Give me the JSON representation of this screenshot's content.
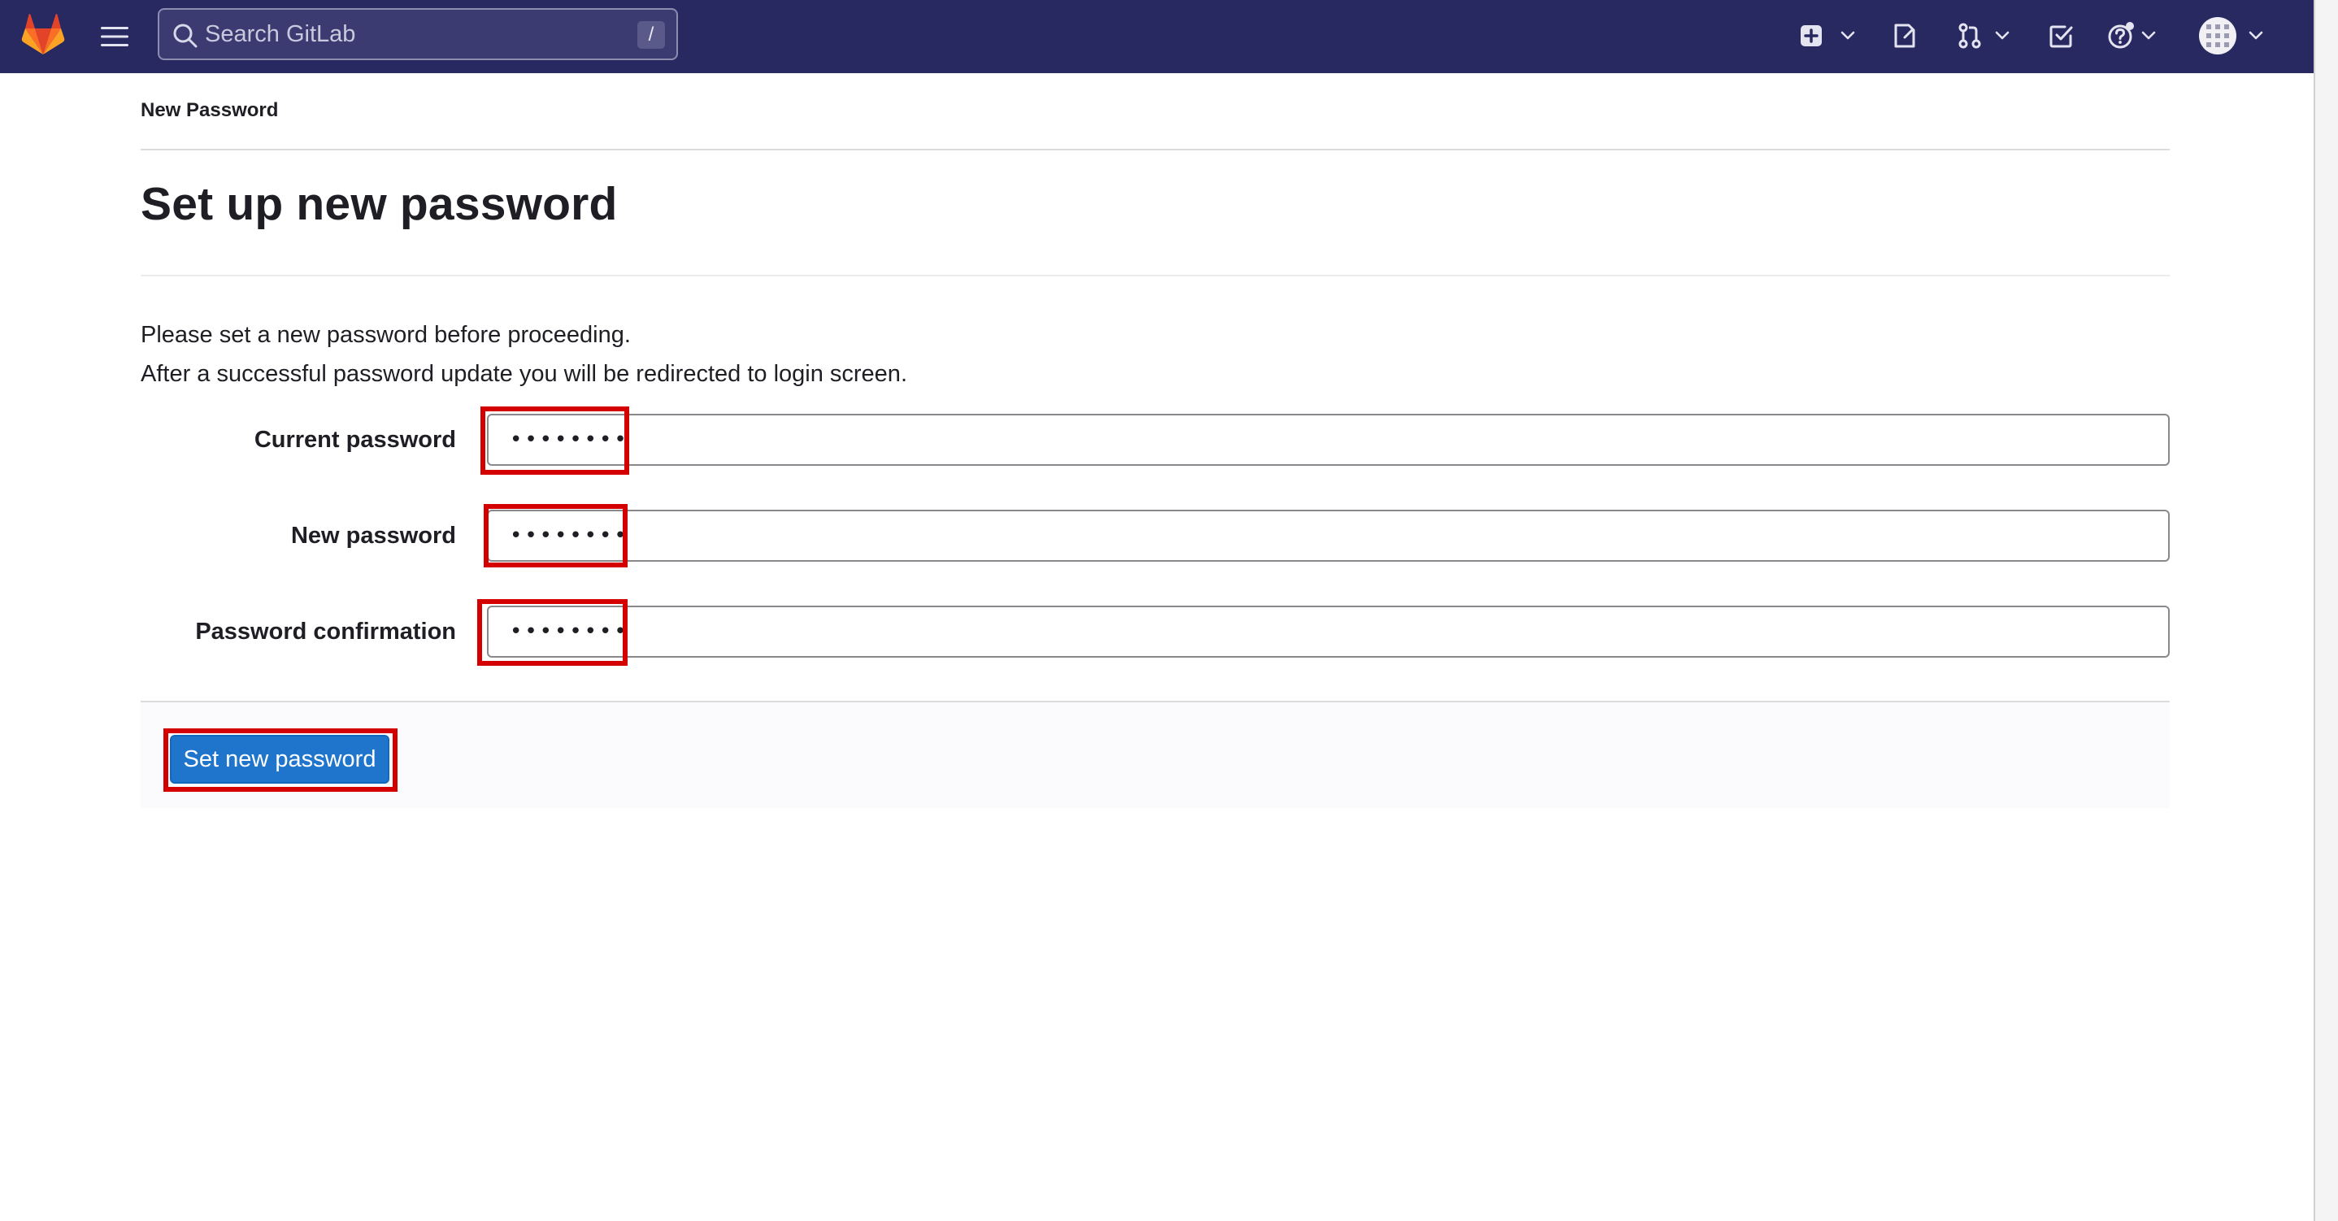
{
  "header": {
    "search": {
      "placeholder": "Search GitLab",
      "shortcut": "/"
    },
    "icons": [
      "gitlab-logo",
      "hamburger-menu-icon",
      "create-new-icon",
      "issues-icon",
      "merge-requests-icon",
      "todos-icon",
      "help-icon",
      "user-avatar"
    ],
    "colors": {
      "bar": "#292961",
      "logo": "#e24329"
    }
  },
  "breadcrumb": "New Password",
  "page": {
    "title": "Set up new password",
    "intro_line1": "Please set a new password before proceeding.",
    "intro_line2": "After a successful password update you will be redirected to login screen."
  },
  "form": {
    "current_password": {
      "label": "Current password",
      "value": "••••••••"
    },
    "new_password": {
      "label": "New password",
      "value": "••••••••"
    },
    "password_confirmation": {
      "label": "Password confirmation",
      "value": "••••••••"
    },
    "submit_label": "Set new password",
    "accent": "#1f75cb",
    "highlight_color": "#d40000"
  }
}
